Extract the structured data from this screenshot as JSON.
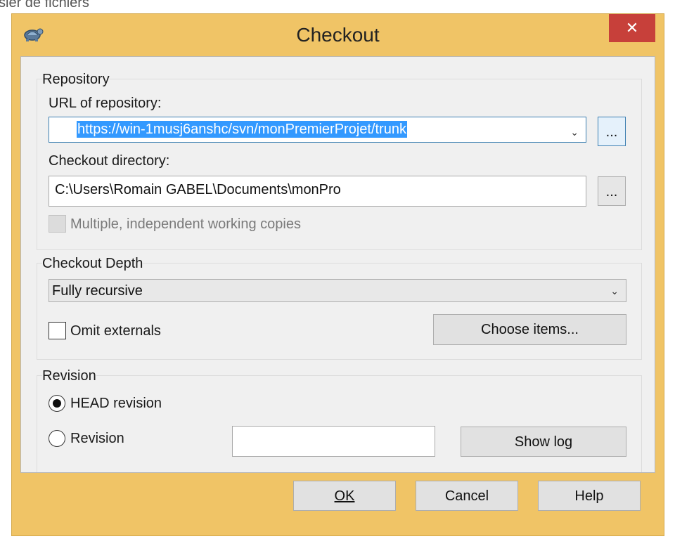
{
  "background": {
    "explorer_text": "ssier de fichiers"
  },
  "window": {
    "title": "Checkout",
    "close_glyph": "✕",
    "app_icon": "tortoisesvn-icon"
  },
  "repository": {
    "group_label": "Repository",
    "url_label": "URL of repository:",
    "url_value": "https://win-1musj6anshc/svn/monPremierProjet/trunk",
    "url_browse": "...",
    "dir_label": "Checkout directory:",
    "dir_value": "C:\\Users\\Romain GABEL\\Documents\\monPro",
    "dir_browse": "...",
    "multiple_label": "Multiple, independent working copies"
  },
  "depth": {
    "group_label": "Checkout Depth",
    "selected": "Fully recursive",
    "omit_label": "Omit externals",
    "choose_items": "Choose items..."
  },
  "revision": {
    "group_label": "Revision",
    "head_label": "HEAD revision",
    "revision_label": "Revision",
    "revision_value": "",
    "show_log": "Show log"
  },
  "buttons": {
    "ok": "OK",
    "cancel": "Cancel",
    "help": "Help"
  }
}
